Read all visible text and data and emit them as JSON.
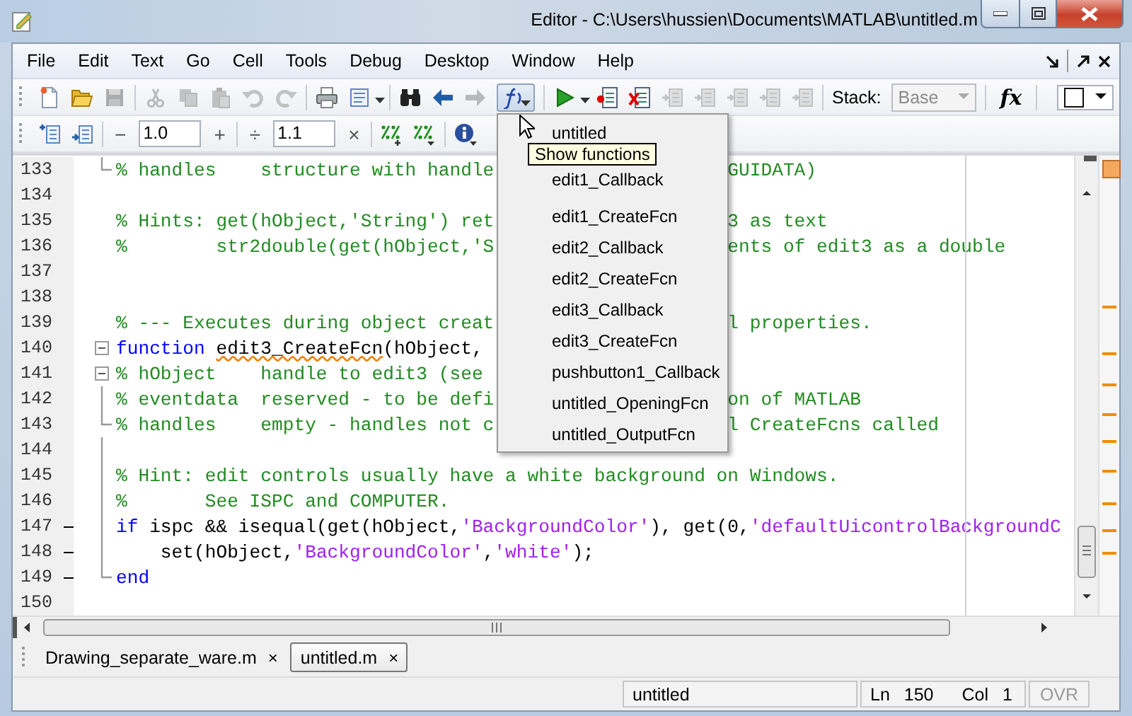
{
  "window": {
    "title": "Editor - C:\\Users\\hussien\\Documents\\MATLAB\\untitled.m"
  },
  "menu": [
    "File",
    "Edit",
    "Text",
    "Go",
    "Cell",
    "Tools",
    "Debug",
    "Desktop",
    "Window",
    "Help"
  ],
  "toolbar": {
    "groups": [
      [
        {
          "kind": "new",
          "disabled": false
        },
        {
          "kind": "open",
          "disabled": false
        },
        {
          "kind": "save",
          "disabled": true
        }
      ],
      [
        {
          "kind": "cut",
          "disabled": true
        },
        {
          "kind": "copy",
          "disabled": true
        },
        {
          "kind": "paste",
          "disabled": true
        },
        {
          "kind": "undo",
          "disabled": true
        },
        {
          "kind": "redo",
          "disabled": true
        }
      ],
      [
        {
          "kind": "print",
          "disabled": false
        },
        {
          "kind": "page",
          "disabled": false
        },
        {
          "kind": "caret",
          "disabled": false
        }
      ],
      [
        {
          "kind": "find",
          "disabled": false
        },
        {
          "kind": "back",
          "disabled": false
        },
        {
          "kind": "forward",
          "disabled": true
        },
        {
          "kind": "functions",
          "disabled": false,
          "pressed": true
        }
      ],
      [
        {
          "kind": "run",
          "disabled": false
        },
        {
          "kind": "caret",
          "disabled": false
        },
        {
          "kind": "breakpoint",
          "disabled": false
        },
        {
          "kind": "clear",
          "disabled": false
        },
        {
          "kind": "step",
          "disabled": true
        },
        {
          "kind": "step",
          "disabled": true
        },
        {
          "kind": "step",
          "disabled": true
        },
        {
          "kind": "step",
          "disabled": true
        },
        {
          "kind": "step",
          "disabled": true
        }
      ],
      [
        {
          "kind": "label",
          "text": "Stack:"
        },
        {
          "kind": "dropdown",
          "value": "Base",
          "disabled": true
        }
      ],
      [
        {
          "kind": "fx",
          "text": "fx"
        }
      ]
    ],
    "right": [
      {
        "kind": "color"
      }
    ]
  },
  "cell_toolbar": {
    "groups": [
      [
        {
          "kind": "insert-cell"
        },
        {
          "kind": "cell-break"
        }
      ],
      [
        {
          "kind": "button",
          "text": "−"
        },
        {
          "kind": "field",
          "value": "1.0"
        },
        {
          "kind": "button",
          "text": "+"
        }
      ],
      [
        {
          "kind": "button",
          "text": "÷"
        },
        {
          "kind": "field",
          "value": "1.1"
        },
        {
          "kind": "button",
          "text": "×"
        }
      ],
      [
        {
          "kind": "percent-plus"
        },
        {
          "kind": "percent"
        }
      ],
      [
        {
          "kind": "info"
        }
      ]
    ]
  },
  "editor": {
    "lines": [
      {
        "number": "133",
        "block_end": true,
        "tokens": [
          {
            "kind": "comment",
            "text": "% handles    structure with handle"
          }
        ],
        "tail": [
          {
            "kind": "comment",
            "text": "GUIDATA)"
          }
        ]
      },
      {
        "number": "134"
      },
      {
        "number": "135",
        "tokens": [
          {
            "kind": "comment",
            "text": "% Hints: get(hObject,'String') ret"
          }
        ],
        "tail": [
          {
            "kind": "comment",
            "text": "3 as text"
          }
        ]
      },
      {
        "number": "136",
        "tokens": [
          {
            "kind": "comment",
            "text": "%        str2double(get(hObject,'S"
          }
        ],
        "tail": [
          {
            "kind": "comment",
            "text": "ents of edit3 as a double"
          }
        ]
      },
      {
        "number": "137"
      },
      {
        "number": "138"
      },
      {
        "number": "139",
        "tokens": [
          {
            "kind": "comment",
            "text": "% --- Executes during object creat"
          }
        ],
        "tail": [
          {
            "kind": "comment",
            "text": "l properties."
          }
        ]
      },
      {
        "number": "140",
        "collapsible": true,
        "tokens": [
          {
            "kind": "keyword",
            "text": "function "
          },
          {
            "kind": "plain",
            "text": "edit3_CreateFcn",
            "warning": true
          },
          {
            "kind": "plain",
            "text": "(hObject, "
          }
        ]
      },
      {
        "number": "141",
        "collapsible": true,
        "tokens": [
          {
            "kind": "comment",
            "text": "% hObject    handle to edit3 (see "
          }
        ]
      },
      {
        "number": "142",
        "in_block": true,
        "tokens": [
          {
            "kind": "comment",
            "text": "% eventdata  reserved - to be defi"
          }
        ],
        "tail": [
          {
            "kind": "comment",
            "text": "on of MATLAB"
          }
        ]
      },
      {
        "number": "143",
        "block_end": true,
        "tokens": [
          {
            "kind": "comment",
            "text": "% handles    empty - handles not c"
          }
        ],
        "tail": [
          {
            "kind": "comment",
            "text": "l CreateFcns called"
          }
        ]
      },
      {
        "number": "144",
        "in_block": true
      },
      {
        "number": "145",
        "in_block": true,
        "tokens": [
          {
            "kind": "comment",
            "text": "% Hint: edit controls usually have a white background on Windows."
          }
        ]
      },
      {
        "number": "146",
        "in_block": true,
        "tokens": [
          {
            "kind": "comment",
            "text": "%       See ISPC and COMPUTER."
          }
        ]
      },
      {
        "number": "147",
        "in_block": true,
        "executable": true,
        "tokens": [
          {
            "kind": "keyword",
            "text": "if"
          },
          {
            "kind": "plain",
            "text": " ispc && isequal(get(hObject,"
          },
          {
            "kind": "string",
            "text": "'BackgroundColor'"
          },
          {
            "kind": "plain",
            "text": "), get(0,"
          },
          {
            "kind": "string",
            "text": "'defaultUicontrolBackgroundC"
          }
        ]
      },
      {
        "number": "148",
        "in_block": true,
        "executable": true,
        "tokens": [
          {
            "kind": "plain",
            "text": "    set(hObject,"
          },
          {
            "kind": "string",
            "text": "'BackgroundColor'"
          },
          {
            "kind": "plain",
            "text": ","
          },
          {
            "kind": "string",
            "text": "'white'"
          },
          {
            "kind": "plain",
            "text": ");"
          }
        ]
      },
      {
        "number": "149",
        "block_end": true,
        "executable": true,
        "tokens": [
          {
            "kind": "keyword",
            "text": "end"
          }
        ]
      },
      {
        "number": "150"
      }
    ]
  },
  "function_menu": {
    "items": [
      "untitled",
      "edit1_Callback",
      "edit1_CreateFcn",
      "edit2_Callback",
      "edit2_CreateFcn",
      "edit3_Callback",
      "edit3_CreateFcn",
      "pushbutton1_Callback",
      "untitled_OpeningFcn",
      "untitled_OutputFcn"
    ],
    "tooltip": "Show functions"
  },
  "tabs": [
    {
      "label": "Drawing_separate_ware.m",
      "close": "×",
      "selected": false
    },
    {
      "label": "untitled.m",
      "close": "×",
      "selected": true
    }
  ],
  "status_bar": {
    "file": "untitled",
    "ln_label": "Ln",
    "ln": "150",
    "col_label": "Col",
    "col": "1",
    "ovr": "OVR",
    "overwrite": false
  }
}
